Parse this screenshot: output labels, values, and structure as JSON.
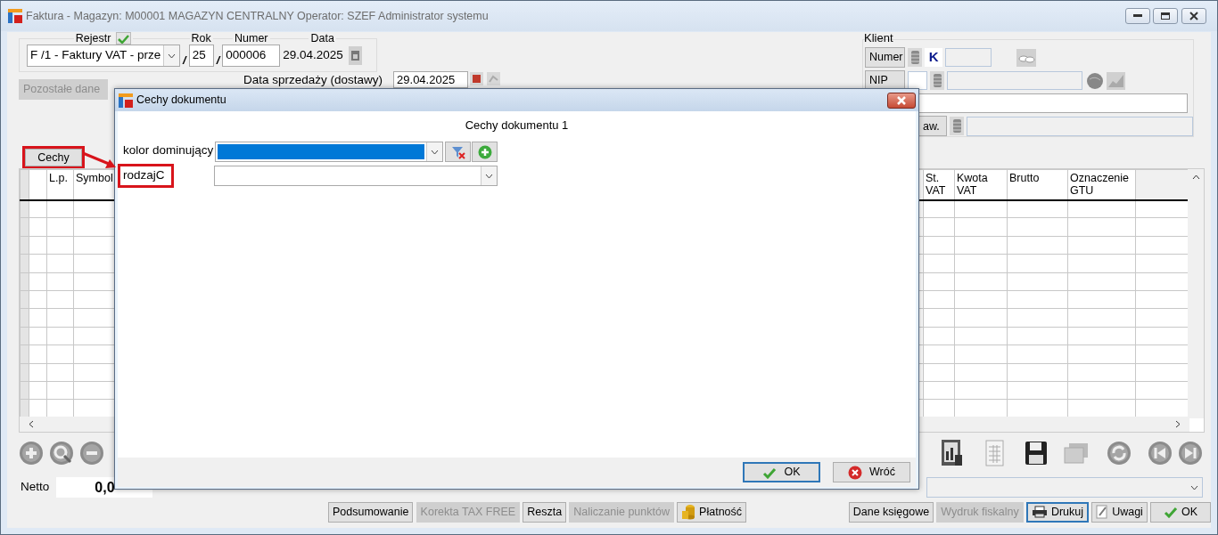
{
  "window": {
    "title": "Faktura - Magazyn: M00001 MAGAZYN CENTRALNY  Operator: SZEF Administrator systemu"
  },
  "header": {
    "rejestr_label": "Rejestr",
    "rejestr_checked": true,
    "rok_label": "Rok",
    "numer_label": "Numer",
    "data_label": "Data",
    "rejestr_value": "F /1   - Faktury VAT - prze",
    "separator_1": "/",
    "rok_value": "25",
    "separator_2": "/",
    "numer_value": "000006",
    "data_value": "29.04.2025"
  },
  "other_data_button": {
    "label": "Pozostałe dane",
    "disabled": true
  },
  "sale_date": {
    "label": "Data sprzedaży (dostawy)",
    "value": "29.04.2025"
  },
  "client": {
    "title": "Klient",
    "numer_button": "Numer",
    "k_label": "K",
    "nip_button": "NIP",
    "row4_button": "aw."
  },
  "cechy_button": {
    "label": "Cechy",
    "highlighted": true
  },
  "grid": {
    "left_columns": [
      "L.p.",
      "Symbol"
    ],
    "right_columns": [
      "St.\nVAT",
      "Kwota\nVAT",
      "Brutto",
      "Oznaczenie\nGTU"
    ]
  },
  "totals": {
    "netto_label": "Netto",
    "netto_value": "0,0"
  },
  "buttons_left": [
    {
      "label": "Podsumowanie",
      "kind": "plain",
      "disabled": false,
      "focused": false
    },
    {
      "label": "Korekta TAX FREE",
      "kind": "plain",
      "disabled": true,
      "focused": false
    },
    {
      "label": "Reszta",
      "kind": "plain",
      "disabled": false,
      "focused": false
    },
    {
      "label": "Naliczanie punktów",
      "kind": "plain",
      "disabled": true,
      "focused": false
    },
    {
      "label": "Płatność",
      "kind": "payment",
      "disabled": false,
      "focused": false
    }
  ],
  "buttons_right": [
    {
      "label": "Dane księgowe",
      "kind": "plain",
      "disabled": false,
      "focused": false
    },
    {
      "label": "Wydruk fiskalny",
      "kind": "plain",
      "disabled": true,
      "focused": false
    },
    {
      "label": "Drukuj",
      "kind": "print",
      "disabled": false,
      "focused": true
    },
    {
      "label": "Uwagi",
      "kind": "notes",
      "disabled": false,
      "focused": false
    },
    {
      "label": "OK",
      "kind": "confirm",
      "disabled": false,
      "focused": false
    }
  ],
  "dialog": {
    "title": "Cechy dokumentu",
    "heading": "Cechy dokumentu 1",
    "features": [
      {
        "label": "kolor dominujący",
        "kind": "filterable",
        "selected": true,
        "highlighted": false
      },
      {
        "label": "rodzajC",
        "kind": "plain",
        "selected": false,
        "highlighted": true
      }
    ],
    "buttons": [
      {
        "label": "OK",
        "kind": "confirm",
        "focused": true
      },
      {
        "label": "Wróć",
        "kind": "cancel",
        "focused": false
      }
    ]
  }
}
